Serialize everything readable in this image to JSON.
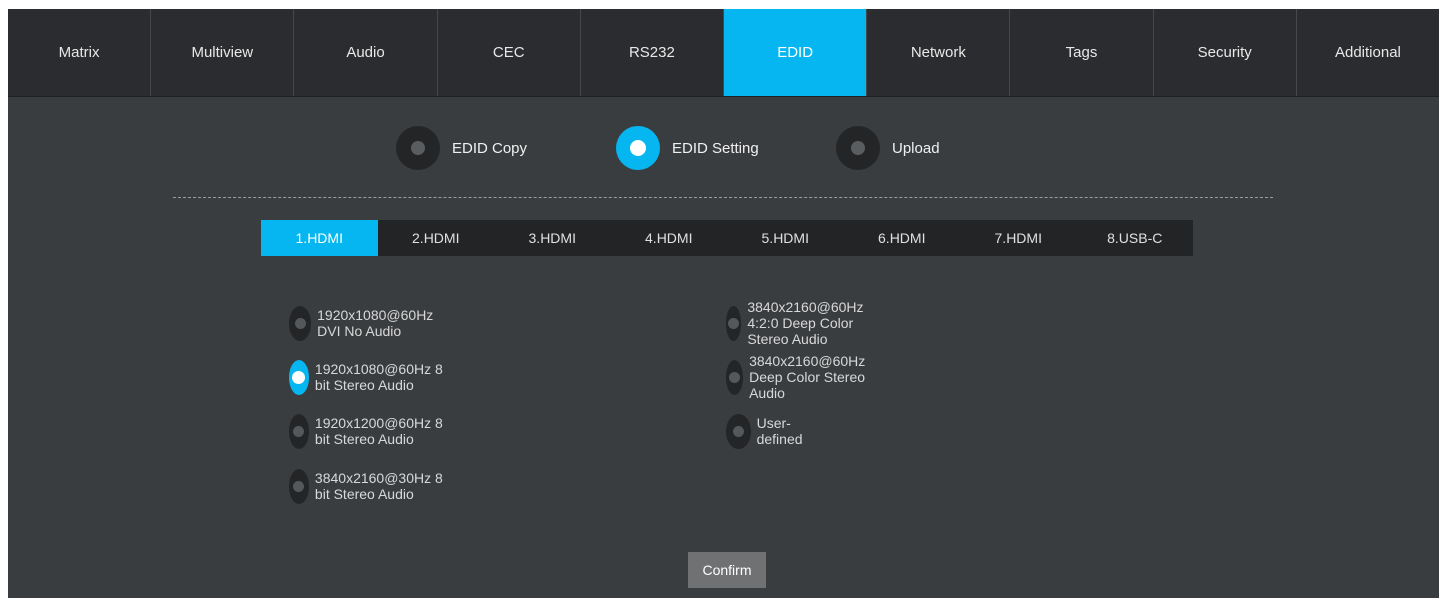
{
  "nav": {
    "tabs": [
      {
        "label": "Matrix"
      },
      {
        "label": "Multiview"
      },
      {
        "label": "Audio"
      },
      {
        "label": "CEC"
      },
      {
        "label": "RS232"
      },
      {
        "label": "EDID",
        "active": true
      },
      {
        "label": "Network"
      },
      {
        "label": "Tags"
      },
      {
        "label": "Security"
      },
      {
        "label": "Additional"
      }
    ]
  },
  "modes": {
    "items": [
      {
        "label": "EDID Copy",
        "selected": false
      },
      {
        "label": "EDID Setting",
        "selected": true
      },
      {
        "label": "Upload",
        "selected": false
      }
    ]
  },
  "ports": {
    "items": [
      {
        "label": "1.HDMI",
        "selected": true
      },
      {
        "label": "2.HDMI"
      },
      {
        "label": "3.HDMI"
      },
      {
        "label": "4.HDMI"
      },
      {
        "label": "5.HDMI"
      },
      {
        "label": "6.HDMI"
      },
      {
        "label": "7.HDMI"
      },
      {
        "label": "8.USB-C"
      }
    ]
  },
  "edid_options": {
    "left": [
      {
        "label": "1920x1080@60Hz DVI No Audio",
        "selected": false
      },
      {
        "label": "1920x1080@60Hz 8 bit Stereo Audio",
        "selected": true
      },
      {
        "label": "1920x1200@60Hz 8 bit Stereo Audio",
        "selected": false
      },
      {
        "label": "3840x2160@30Hz 8 bit Stereo Audio",
        "selected": false
      }
    ],
    "right": [
      {
        "label": "3840x2160@60Hz 4:2:0 Deep Color Stereo Audio",
        "selected": false
      },
      {
        "label": "3840x2160@60Hz Deep Color Stereo Audio",
        "selected": false
      },
      {
        "label": "User-defined",
        "selected": false
      }
    ]
  },
  "actions": {
    "confirm_label": "Confirm"
  },
  "colors": {
    "accent": "#06b6f0",
    "panel": "#3a3d40",
    "nav": "#2a2c2f",
    "port_bar": "#222426",
    "button": "#6f7173"
  }
}
